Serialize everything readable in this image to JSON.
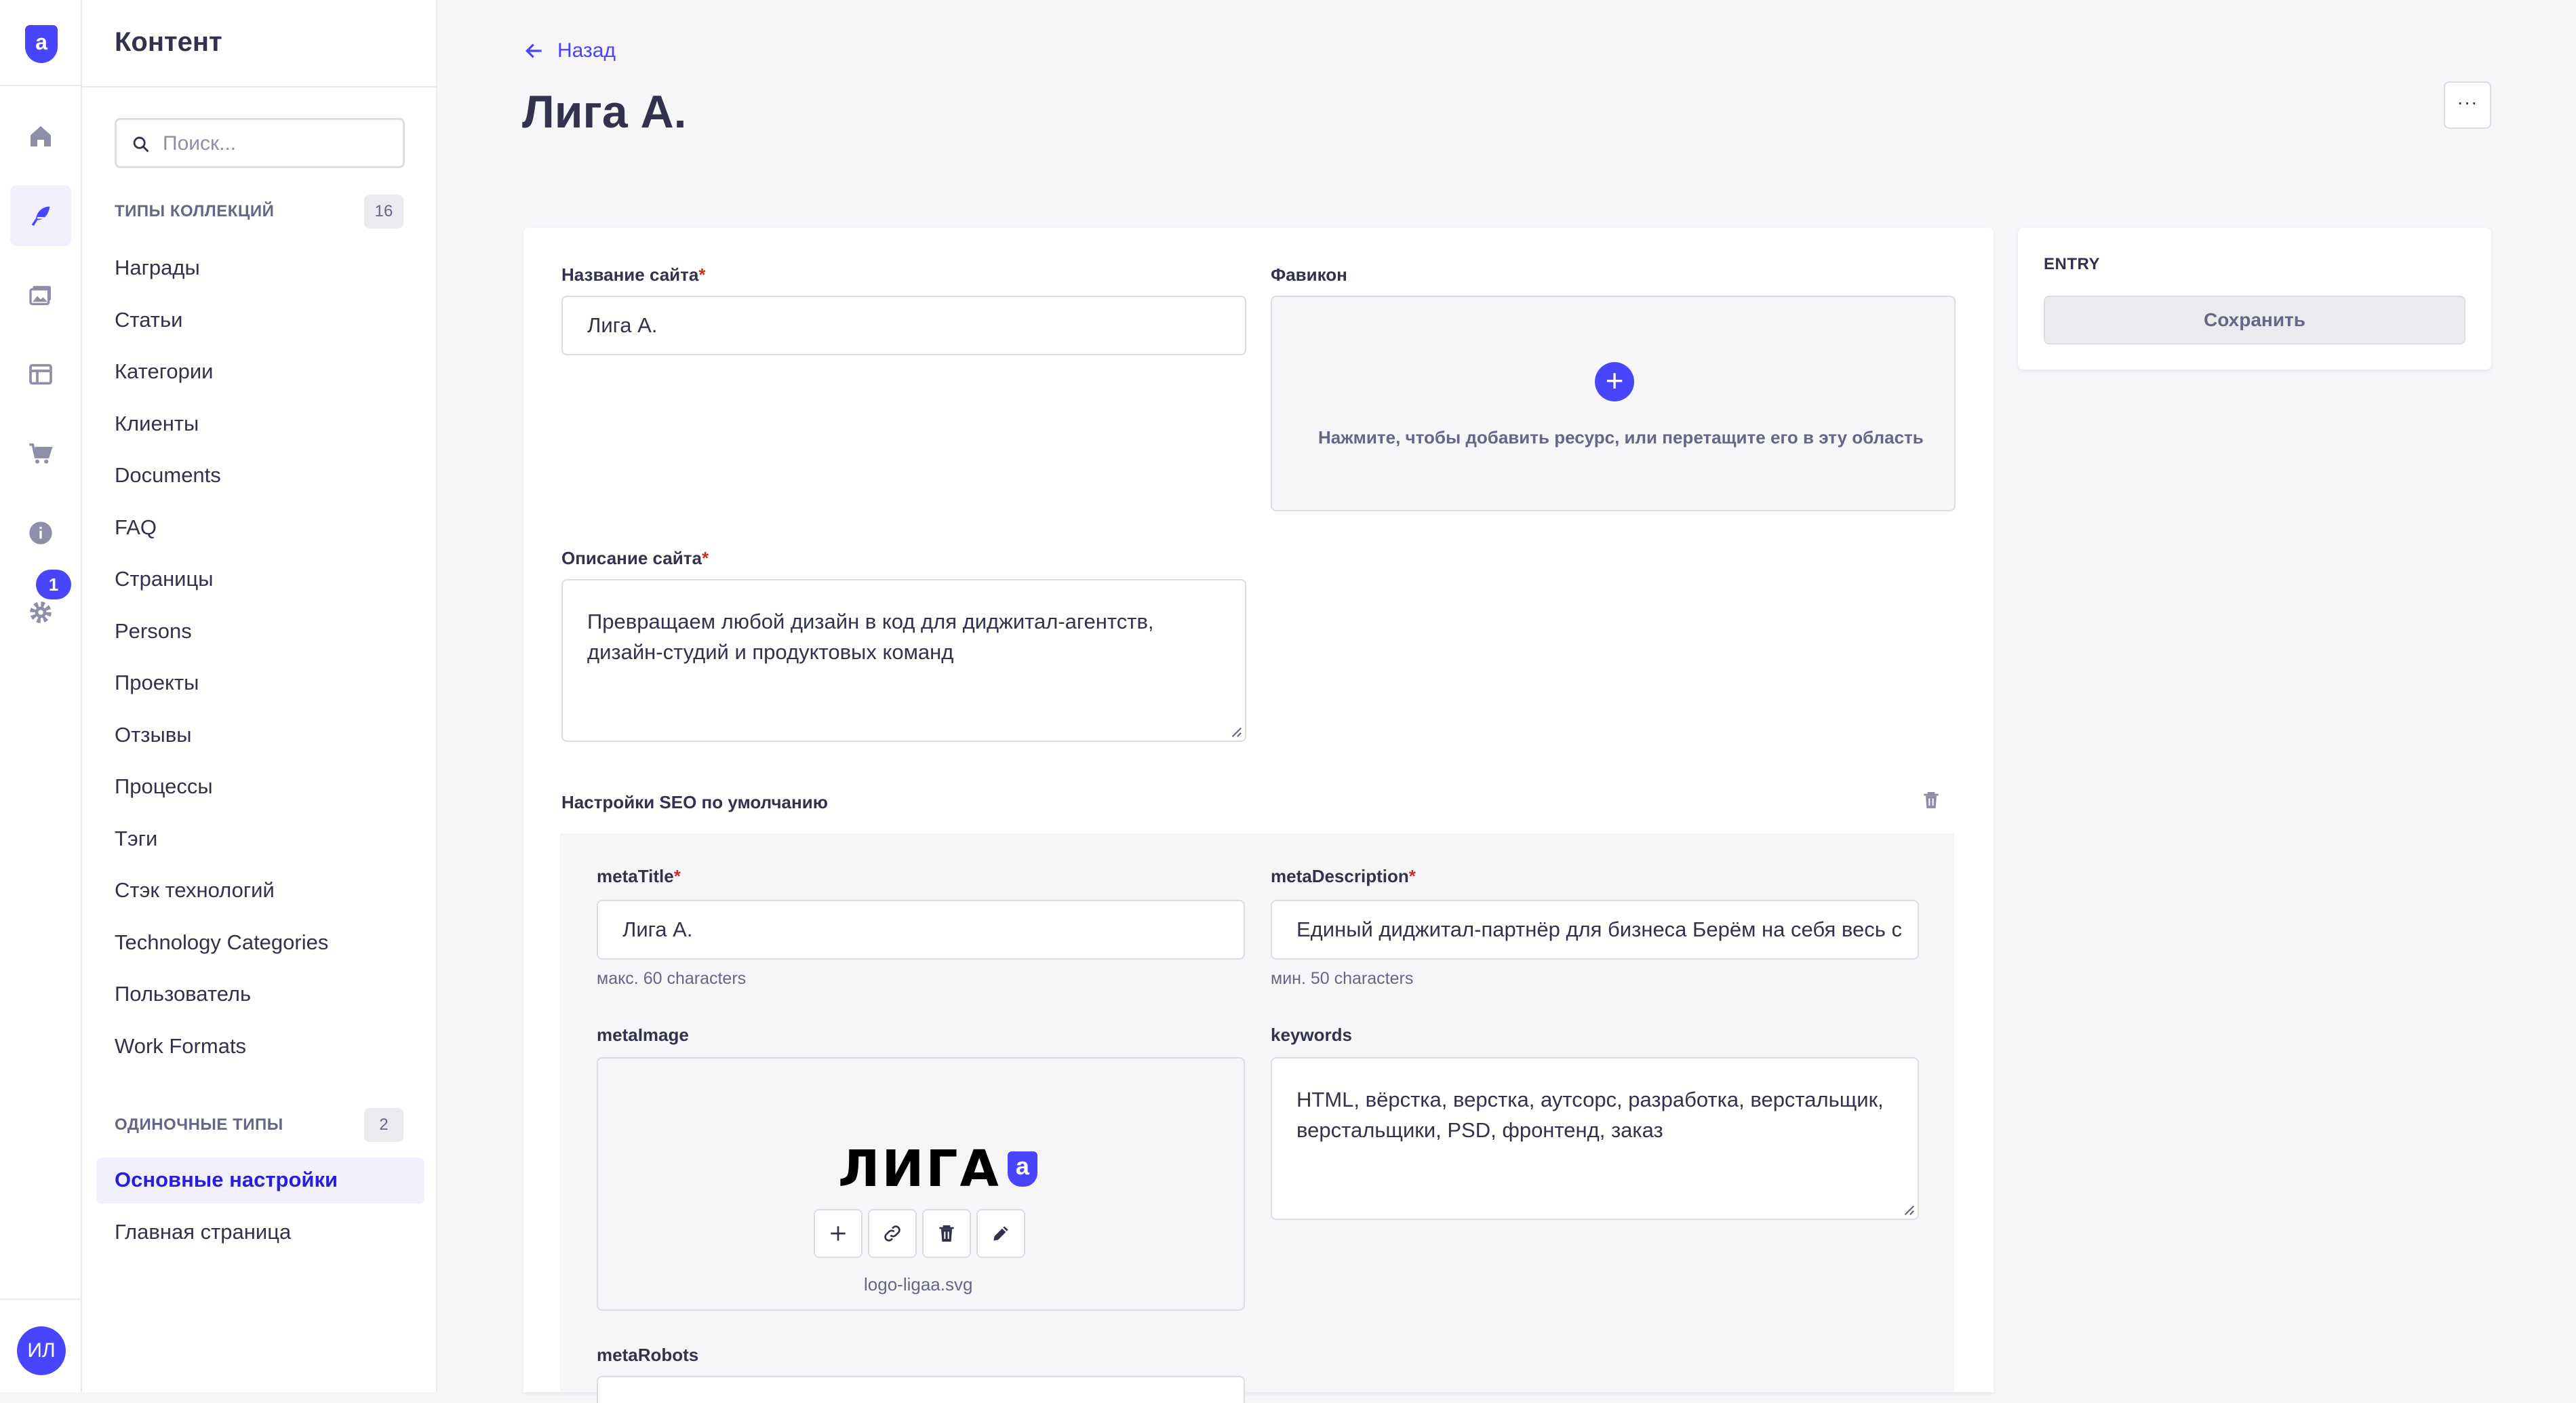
{
  "rail": {
    "logo": "a",
    "badge": "1",
    "avatar": "ИЛ"
  },
  "sidebar": {
    "title": "Контент",
    "search_placeholder": "Поиск...",
    "collections_header": "ТИПЫ КОЛЛЕКЦИЙ",
    "collections_count": "16",
    "collections": [
      "Награды",
      "Статьи",
      "Категории",
      "Клиенты",
      "Documents",
      "FAQ",
      "Страницы",
      "Persons",
      "Проекты",
      "Отзывы",
      "Процессы",
      "Тэги",
      "Стэк технологий",
      "Technology Categories",
      "Пользователь",
      "Work Formats"
    ],
    "singles_header": "ОДИНОЧНЫЕ ТИПЫ",
    "singles_count": "2",
    "singles": [
      "Основные настройки",
      "Главная страница"
    ]
  },
  "header": {
    "back_label": "Назад",
    "title": "Лига А.",
    "more_label": "···"
  },
  "form": {
    "site_name_label": "Название сайта",
    "site_name_value": "Лига А.",
    "favicon_label": "Фавикон",
    "favicon_hint": "Нажмите, чтобы добавить ресурс, или перетащите его в эту область",
    "site_desc_label": "Описание сайта",
    "site_desc_value": "Превращаем любой дизайн в код для диджитал-агентств, дизайн-студий и продуктовых команд",
    "required_mark": "*",
    "seo_label": "Настройки SEO по умолчанию",
    "meta_title_label": "metaTitle",
    "meta_title_value": "Лига А.",
    "meta_title_hint": "макс. 60 characters",
    "meta_desc_label": "metaDescription",
    "meta_desc_value": "Единый диджитал-партнёр для бизнеса Берём на себя весь с",
    "meta_desc_hint": "мин. 50 characters",
    "meta_image_label": "metaImage",
    "meta_image_logo_text": "ЛИГА",
    "meta_image_logo_mark": "a",
    "meta_image_file": "logo-ligaa.svg",
    "keywords_label": "keywords",
    "keywords_value": "HTML, вёрстка, верстка, аутсорс, разработка, верстальщик, верстальщики, PSD, фронтенд, заказ",
    "meta_robots_label": "metaRobots"
  },
  "entry": {
    "label": "ENTRY",
    "save_label": "Сохранить"
  },
  "colors": {
    "accent": "#4945ff",
    "danger": "#d02b20",
    "text": "#32324d",
    "muted": "#666687",
    "bg": "#f6f6f9"
  }
}
